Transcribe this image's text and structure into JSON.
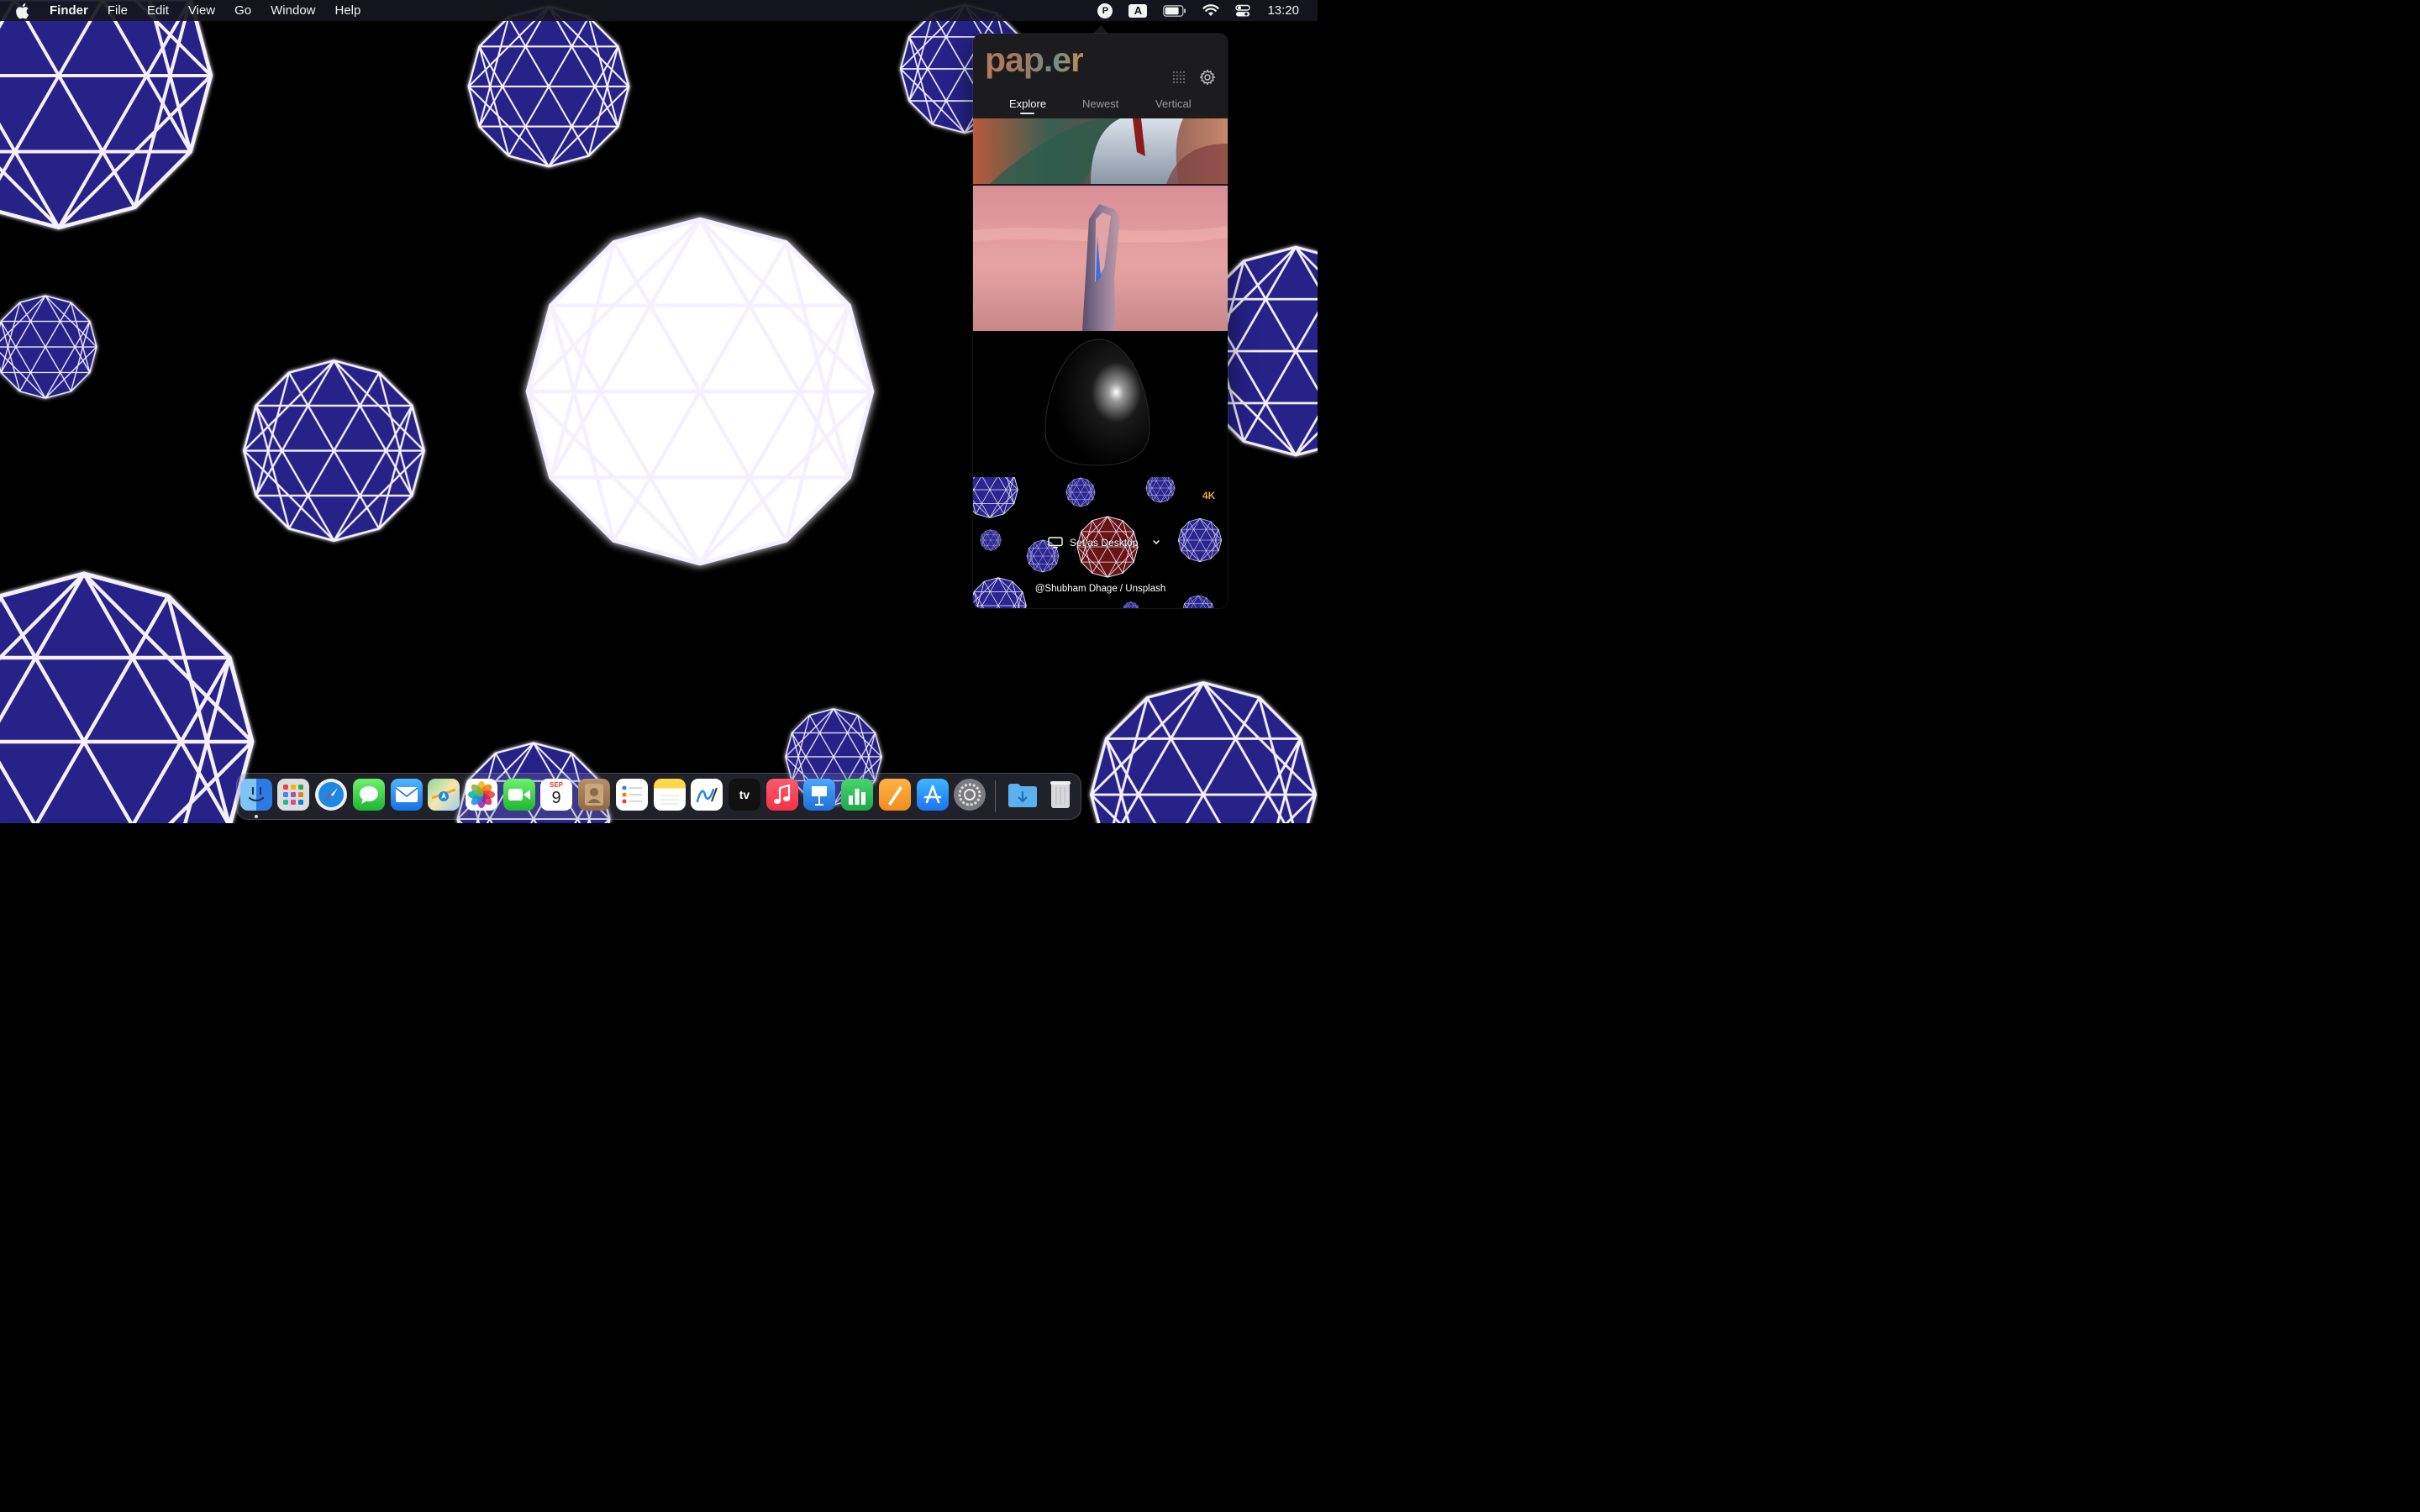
{
  "menubar": {
    "app_name": "Finder",
    "menus": [
      "File",
      "Edit",
      "View",
      "Go",
      "Window",
      "Help"
    ],
    "status_p": "P",
    "status_a": "A",
    "clock": "13:20"
  },
  "popover": {
    "logo": "pap.er",
    "tabs": [
      "Explore",
      "Newest",
      "Vertical"
    ],
    "active_tab": "Explore",
    "resolution_badge": "4K",
    "set_desktop_label": "Set as Desktop",
    "credit": "@Shubham Dhage / Unsplash",
    "accent_color": "#e9a23b"
  },
  "dock": {
    "apps": [
      {
        "name": "Finder",
        "icon": "finder-icon"
      },
      {
        "name": "Launchpad",
        "icon": "launchpad-icon"
      },
      {
        "name": "Safari",
        "icon": "safari-icon"
      },
      {
        "name": "Messages",
        "icon": "messages-icon"
      },
      {
        "name": "Mail",
        "icon": "mail-icon"
      },
      {
        "name": "Maps",
        "icon": "maps-icon"
      },
      {
        "name": "Photos",
        "icon": "photos-icon"
      },
      {
        "name": "FaceTime",
        "icon": "facetime-icon"
      },
      {
        "name": "Calendar",
        "icon": "calendar-icon"
      },
      {
        "name": "Contacts",
        "icon": "contacts-icon"
      },
      {
        "name": "Reminders",
        "icon": "reminders-icon"
      },
      {
        "name": "Notes",
        "icon": "notes-icon"
      },
      {
        "name": "Freeform",
        "icon": "freeform-icon"
      },
      {
        "name": "TV",
        "icon": "tv-icon"
      },
      {
        "name": "Music",
        "icon": "music-icon"
      },
      {
        "name": "Keynote",
        "icon": "keynote-icon"
      },
      {
        "name": "Numbers",
        "icon": "numbers-icon"
      },
      {
        "name": "Pages",
        "icon": "pages-icon"
      },
      {
        "name": "App Store",
        "icon": "appstore-icon"
      },
      {
        "name": "System Settings",
        "icon": "settings-icon"
      },
      {
        "name": "Downloads",
        "icon": "downloads-folder-icon"
      },
      {
        "name": "Trash",
        "icon": "trash-icon"
      }
    ],
    "calendar_month": "SEP",
    "calendar_day": "9",
    "tv_label": "tv"
  }
}
